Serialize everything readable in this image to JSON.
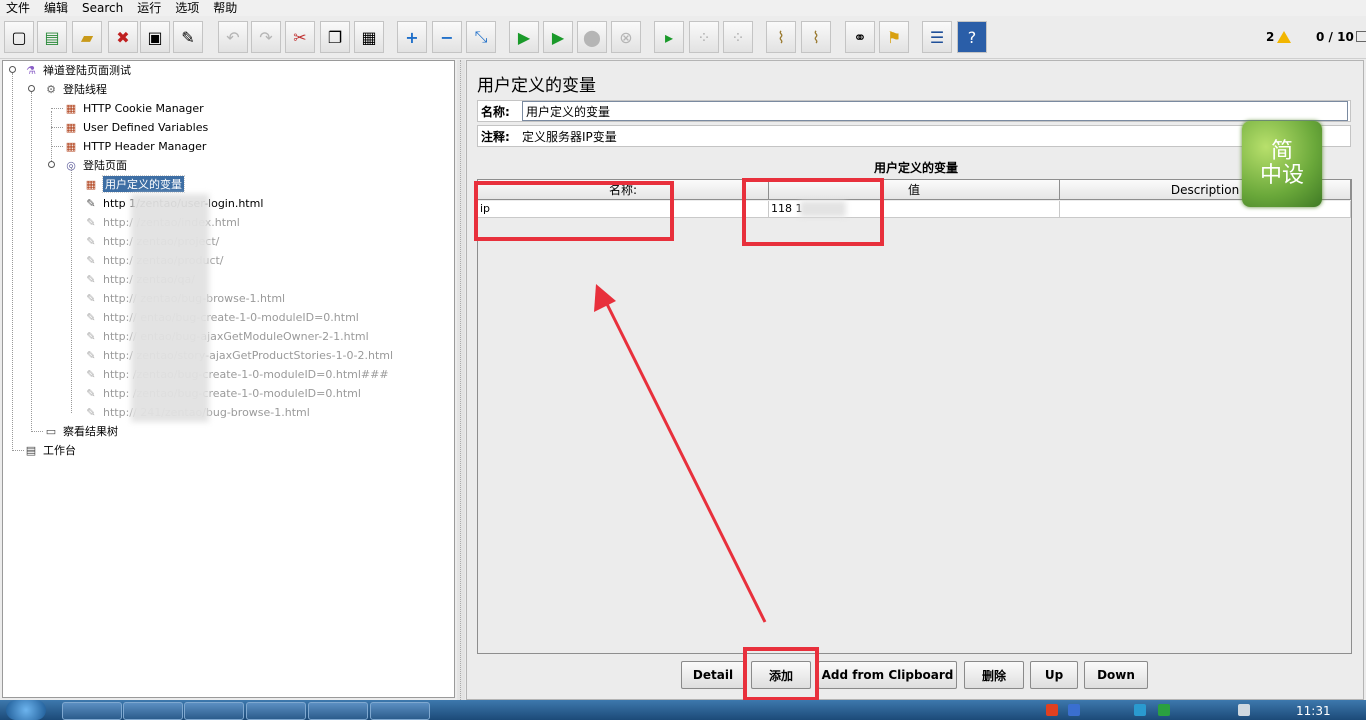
{
  "menu": [
    "文件",
    "编辑",
    "Search",
    "运行",
    "选项",
    "帮助"
  ],
  "toolbar": {
    "status_warn_count": "2",
    "status_threads": "0 / 10"
  },
  "tree": {
    "root": "禅道登陆页面测试",
    "thread_group": "登陆线程",
    "cookie": "HTTP Cookie Manager",
    "udv": "User Defined Variables",
    "header": "HTTP Header Manager",
    "login_page": "登陆页面",
    "selected": "用户定义的变量",
    "samplers": [
      "http         1/zentao/user-login.html",
      "http:/           /zentao/index.html",
      "http:/           zentao/project/",
      "http:/           zentao/product/",
      "http:/           zentao/qa/",
      "http://           zentao/bug-browse-1.html",
      "http://           entao/bug-create-1-0-moduleID=0.html",
      "http://           entao/bug-ajaxGetModuleOwner-2-1.html",
      "http:/           zentao/story-ajaxGetProductStories-1-0-2.html",
      "http:           /zentao/bug-create-1-0-moduleID=0.html###",
      "http:           /zentao/bug-create-1-0-moduleID=0.html",
      "http://          241/zentao/bug-browse-1.html"
    ],
    "results_tree": "察看结果树",
    "workbench": "工作台"
  },
  "panel": {
    "title": "用户定义的变量",
    "name_label": "名称:",
    "name_value": "用户定义的变量",
    "comment_label": "注释:",
    "comment_value": "定义服务器IP变量",
    "table_caption": "用户定义的变量",
    "columns": [
      "名称:",
      "值",
      "Description"
    ],
    "rows": [
      {
        "name": "ip",
        "value": "118          1",
        "description": ""
      }
    ],
    "buttons": {
      "detail": "Detail",
      "add": "添加",
      "add_clipboard": "Add from Clipboard",
      "delete": "删除",
      "up": "Up",
      "down": "Down"
    }
  },
  "watermark": [
    "简",
    "中设"
  ],
  "taskbar": {
    "clock": "11:31"
  },
  "colors": {
    "annotation_red": "#e8303c",
    "selection_blue": "#3d6ea4"
  }
}
